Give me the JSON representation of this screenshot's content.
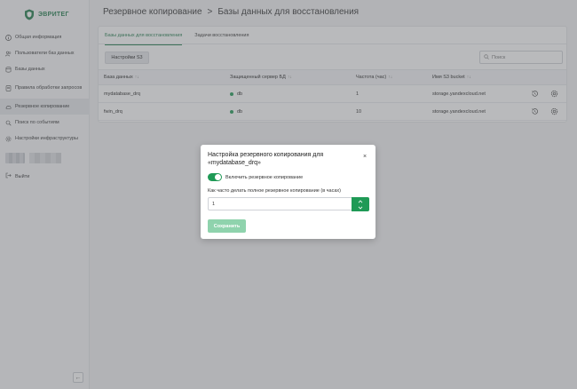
{
  "app": {
    "brand": "ЭВРИТЕГ"
  },
  "sidebar": {
    "items": [
      {
        "label": "Общая информация",
        "icon": "info-circle-icon"
      },
      {
        "label": "Пользователи баз данных",
        "icon": "users-icon"
      },
      {
        "label": "Базы данных",
        "icon": "database-icon"
      },
      {
        "label": "Правила обработки запросов",
        "icon": "rules-icon"
      },
      {
        "label": "Резервное копирование",
        "icon": "backup-icon",
        "active": true
      },
      {
        "label": "Поиск по событиям",
        "icon": "search-events-icon"
      },
      {
        "label": "Настройки инфраструктуры",
        "icon": "settings-icon"
      }
    ],
    "logout": "Выйти"
  },
  "header": {
    "breadcrumb_root": "Резервное копирование",
    "separator": ">",
    "breadcrumb_current": "Базы данных для восстановления"
  },
  "tabs": [
    {
      "label": "Базы данных для восстановления",
      "active": true
    },
    {
      "label": "Задачи восстановления",
      "active": false
    }
  ],
  "toolbar": {
    "s3_settings": "Настройки S3",
    "search_placeholder": "Поиск"
  },
  "table": {
    "columns": [
      "База данных",
      "Защищенный сервер БД",
      "Частота (час)",
      "Имя S3 bucket"
    ],
    "sort_glyph": "↑↓",
    "rows": [
      {
        "database": "mydatabase_drq",
        "server": "db",
        "frequency": "1",
        "bucket": "storage.yandexcloud.net"
      },
      {
        "database": "fwin_drq",
        "server": "db",
        "frequency": "10",
        "bucket": "storage.yandexcloud.net"
      }
    ]
  },
  "modal": {
    "title": "Настройка резервного копирования для «mydatabase_drq»",
    "close": "×",
    "toggle_label": "Включить резервное копирование",
    "toggle_on": true,
    "field_label": "Как часто делать полное резервное копирование (в часах)",
    "field_value": "1",
    "save": "Сохранить"
  },
  "colors": {
    "accent": "#1f9a56",
    "brand": "#1e7a4a",
    "save_disabled": "#8fd3ad"
  }
}
